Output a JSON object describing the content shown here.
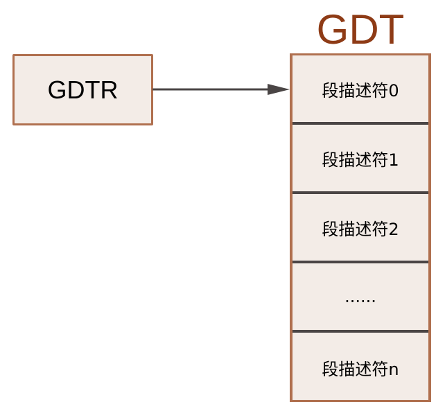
{
  "register": {
    "label": "GDTR"
  },
  "table": {
    "title": "GDT",
    "rows": [
      "段描述符0",
      "段描述符1",
      "段描述符2",
      "......",
      "段描述符n"
    ]
  },
  "colors": {
    "border": "#b0704f",
    "fill": "#f3ece7",
    "title": "#8e3b16",
    "arrow": "#4a4545"
  }
}
